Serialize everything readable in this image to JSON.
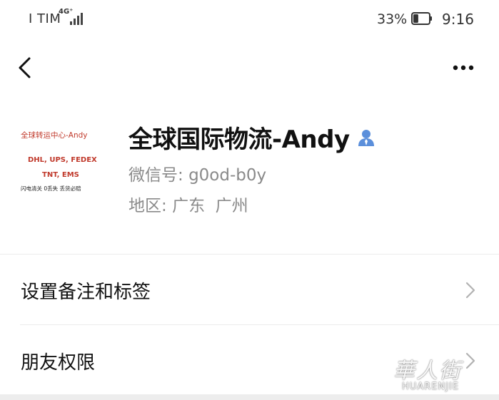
{
  "status_bar": {
    "carrier": "I TIM",
    "network": "4G⁺",
    "battery_percent": "33%",
    "battery_level": 0.33,
    "time": "9:16"
  },
  "nav": {
    "back_icon": "chevron-left-icon",
    "more_icon": "more-dots-icon"
  },
  "profile": {
    "name": "全球国际物流-Andy",
    "wechat_label": "微信号:",
    "wechat_id": "g0od-b0y",
    "region_label": "地区:",
    "region_value": "广东  广州",
    "gender_icon": "person-icon",
    "gender_icon_color": "#5b8fdb",
    "avatar": {
      "title": "全球转运中心-Andy",
      "carriers_line1": "DHL, UPS, FEDEX",
      "carriers_line2": "TNT, EMS",
      "slogan": "闪电清关 0丢失 丢货必赔",
      "text_color": "#c0392b"
    }
  },
  "menu": {
    "items": [
      {
        "label": "设置备注和标签",
        "icon": "chevron-right-icon"
      },
      {
        "label": "朋友权限",
        "icon": "chevron-right-icon"
      }
    ]
  },
  "watermark": {
    "script": "華人街",
    "text": "HUARENJIE"
  },
  "colors": {
    "text_primary": "#111111",
    "text_secondary": "#8a8a8a",
    "divider": "#ececec",
    "chevron": "#b2b2b2"
  }
}
